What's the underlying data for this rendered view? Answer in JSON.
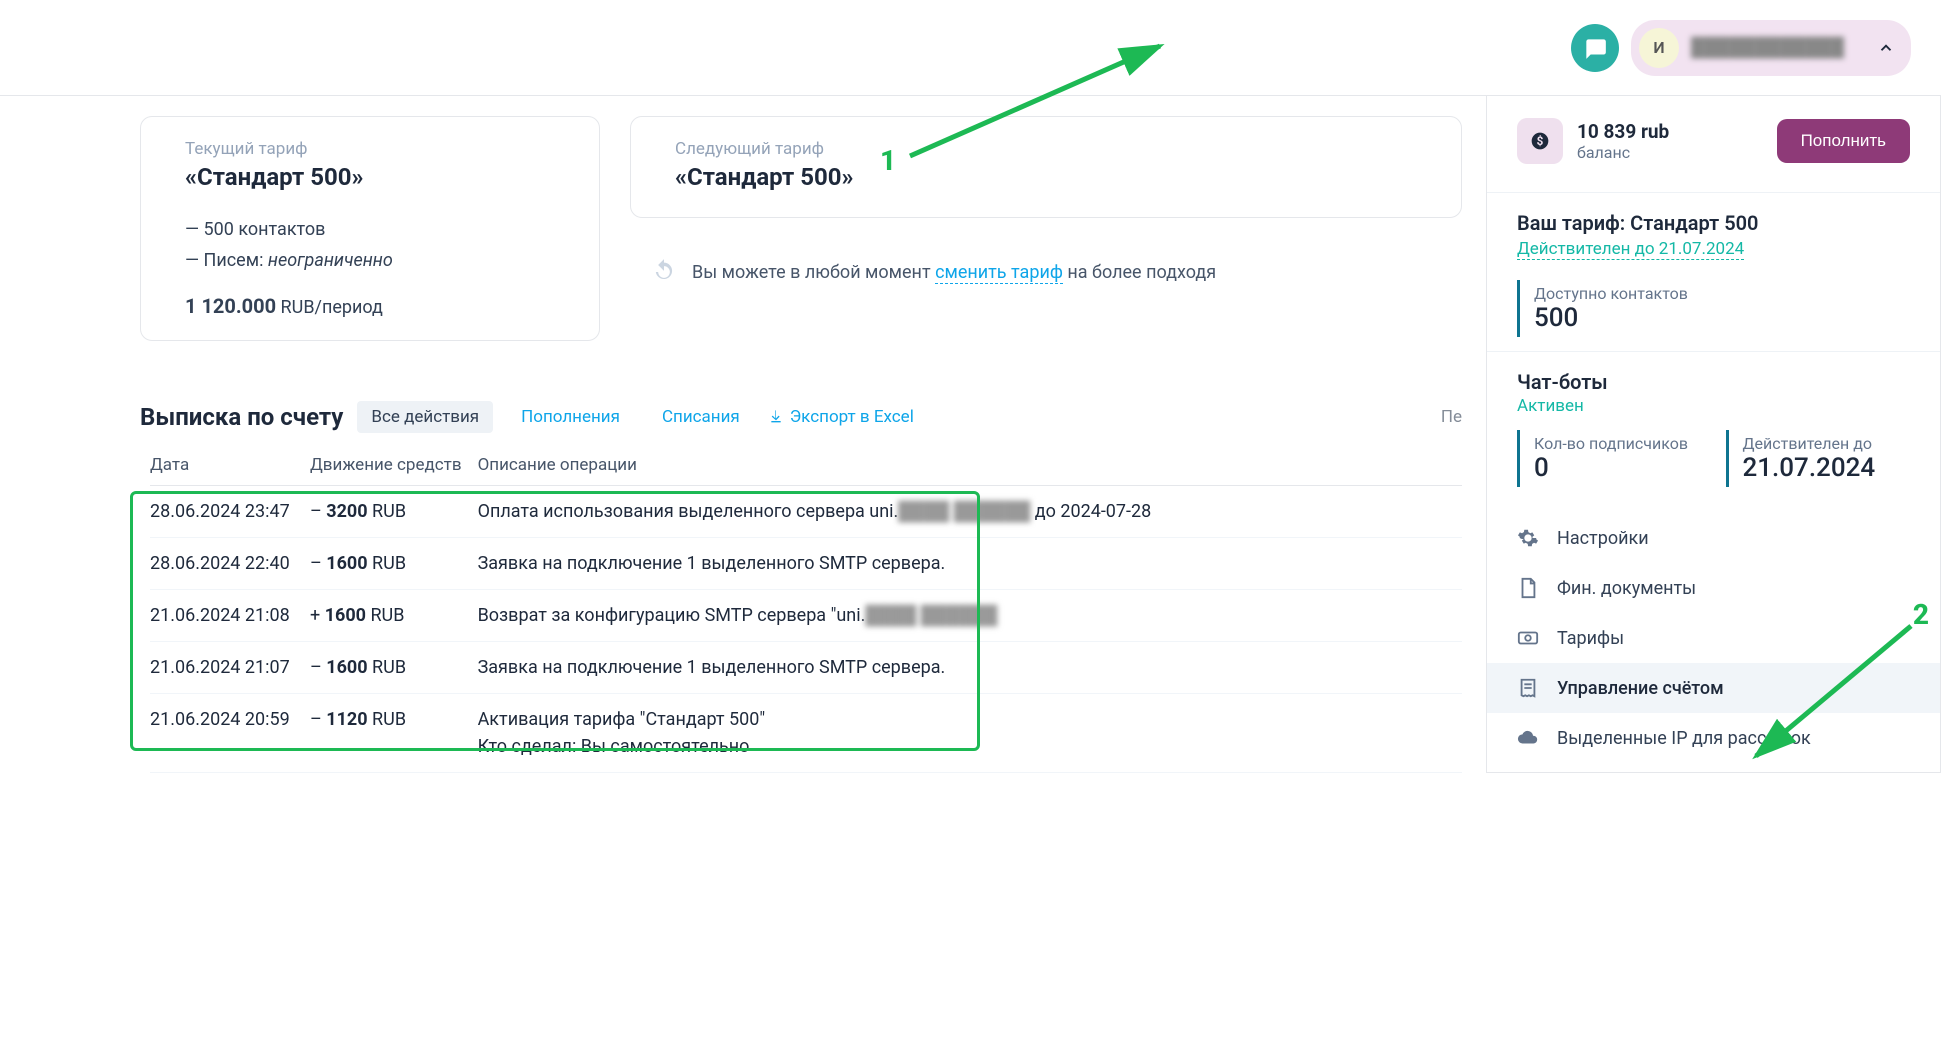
{
  "topbar": {
    "avatar_letter": "И",
    "profile_name": "████████████"
  },
  "current_tariff": {
    "label": "Текущий тариф",
    "name": "«Стандарт 500»",
    "contacts_line": "— 500 контактов",
    "letters_line_prefix": "— Писем: ",
    "letters_line_value": "неограниченно",
    "price_bold": "1 120.000",
    "price_rest": " RUB/период"
  },
  "next_tariff": {
    "label": "Следующий тариф",
    "name": "«Стандарт 500»",
    "hint_before": "Вы можете в любой момент ",
    "hint_link": "сменить тариф",
    "hint_after": " на более подходя"
  },
  "statement": {
    "title": "Выписка по счету",
    "tabs": {
      "all": "Все действия",
      "in": "Пополнения",
      "out": "Списания"
    },
    "export": "Экспорт в Excel",
    "period_trunc": "Пе",
    "cols": {
      "date": "Дата",
      "move": "Движение средств",
      "desc": "Описание операции"
    },
    "rows": [
      {
        "date": "28.06.2024 23:47",
        "sign": "–",
        "amount": "3200",
        "cur": "RUB",
        "positive": false,
        "desc_before": "Оплата использования выделенного сервера uni.",
        "desc_blur": "████ ██████",
        "desc_after": " до 2024-07-28"
      },
      {
        "date": "28.06.2024 22:40",
        "sign": "–",
        "amount": "1600",
        "cur": "RUB",
        "positive": false,
        "desc_before": "Заявка на подключение 1 выделенного SMTP сервера.",
        "desc_blur": "",
        "desc_after": ""
      },
      {
        "date": "21.06.2024 21:08",
        "sign": "+",
        "amount": "1600",
        "cur": "RUB",
        "positive": true,
        "desc_before": "Возврат за конфигурацию SMTP сервера \"uni.",
        "desc_blur": "████ ██████",
        "desc_after": ""
      },
      {
        "date": "21.06.2024 21:07",
        "sign": "–",
        "amount": "1600",
        "cur": "RUB",
        "positive": false,
        "desc_before": "Заявка на подключение 1 выделенного SMTP сервера.",
        "desc_blur": "",
        "desc_after": ""
      },
      {
        "date": "21.06.2024 20:59",
        "sign": "–",
        "amount": "1120",
        "cur": "RUB",
        "positive": false,
        "desc_before": "Активация тарифа \"Стандарт 500\"",
        "desc_blur": "",
        "desc_after": "",
        "desc_line2": "Кто сделал: Вы самостоятельно"
      }
    ]
  },
  "sidebar": {
    "balance_value": "10 839 rub",
    "balance_label": "баланс",
    "topup": "Пополнить",
    "tariff_prefix": "Ваш тариф: ",
    "tariff_name": "Стандарт 500",
    "valid_until": "Действителен до 21.07.2024",
    "contacts_label": "Доступно контактов",
    "contacts_value": "500",
    "bots_title": "Чат-боты",
    "bots_status": "Активен",
    "subs_label": "Кол-во подписчиков",
    "subs_value": "0",
    "valid_label": "Действителен до",
    "valid_value": "21.07.2024",
    "menu": {
      "settings": "Настройки",
      "fin": "Фин. документы",
      "tariffs": "Тарифы",
      "account": "Управление счётом",
      "ips": "Выделенные IP для рассылок"
    }
  },
  "annotations": {
    "n1": "1",
    "n2": "2"
  }
}
